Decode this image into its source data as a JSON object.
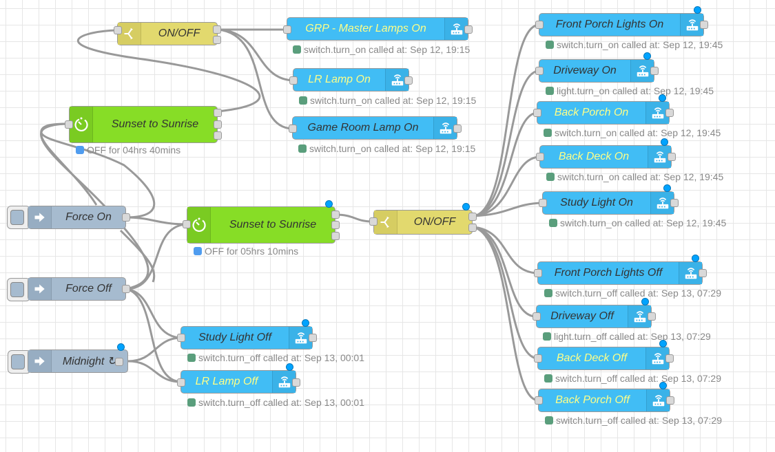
{
  "flow": {
    "colors": {
      "switch_node": "#e2d96e",
      "time_node": "#87dd26",
      "inject_node": "#a6bbcf",
      "ha_service_node": "#41bdf5",
      "status_green": "#5a9e7c",
      "status_blue": "#4f9cef",
      "changed_dot": "#00a3ff",
      "wire": "#999999"
    },
    "nodes": {
      "switch_top": {
        "label": "ON/OFF",
        "icon": "switch-icon"
      },
      "grp_master": {
        "label": "GRP - Master Lamps On",
        "icon": "router-icon",
        "status": "switch.turn_on called at: Sep 12, 19:15"
      },
      "lr_lamp_on": {
        "label": "LR Lamp On",
        "icon": "router-icon",
        "status": "switch.turn_on called at: Sep 12, 19:15"
      },
      "game_room_on": {
        "label": "Game Room Lamp On",
        "icon": "router-icon",
        "status": "switch.turn_on called at: Sep 12, 19:15"
      },
      "sunset_top": {
        "label": "Sunset to Sunrise",
        "icon": "timer-icon",
        "status": "OFF for 04hrs 40mins"
      },
      "force_on": {
        "label": "Force On",
        "icon": "inject-arrow-icon"
      },
      "force_off": {
        "label": "Force Off",
        "icon": "inject-arrow-icon"
      },
      "midnight": {
        "label": "Midnight ↻",
        "icon": "inject-arrow-icon"
      },
      "sunset_mid": {
        "label": "Sunset to Sunrise",
        "icon": "timer-icon",
        "status": "OFF for 05hrs 10mins"
      },
      "switch_mid": {
        "label": "ON/OFF",
        "icon": "switch-icon"
      },
      "study_light_off": {
        "label": "Study Light Off",
        "icon": "router-icon",
        "status": "switch.turn_off called at: Sep 13, 00:01"
      },
      "lr_lamp_off": {
        "label": "LR Lamp Off",
        "icon": "router-icon",
        "status": "switch.turn_off called at: Sep 13, 00:01"
      },
      "front_porch_on": {
        "label": "Front Porch Lights On",
        "icon": "router-icon",
        "status": "switch.turn_on called at: Sep 12, 19:45"
      },
      "driveway_on": {
        "label": "Driveway On",
        "icon": "router-icon",
        "status": "light.turn_on called at: Sep 12, 19:45"
      },
      "back_porch_on": {
        "label": "Back Porch On",
        "icon": "router-icon",
        "status": "switch.turn_on called at: Sep 12, 19:45"
      },
      "back_deck_on": {
        "label": "Back Deck On",
        "icon": "router-icon",
        "status": "switch.turn_on called at: Sep 12, 19:45"
      },
      "study_light_on": {
        "label": "Study Light On",
        "icon": "router-icon",
        "status": "switch.turn_on called at: Sep 12, 19:45"
      },
      "front_porch_off": {
        "label": "Front Porch Lights Off",
        "icon": "router-icon",
        "status": "switch.turn_off called at: Sep 13, 07:29"
      },
      "driveway_off": {
        "label": "Driveway Off",
        "icon": "router-icon",
        "status": "light.turn_off called at: Sep 13, 07:29"
      },
      "back_deck_off": {
        "label": "Back Deck Off",
        "icon": "router-icon",
        "status": "switch.turn_off called at: Sep 13, 07:29"
      },
      "back_porch_off": {
        "label": "Back Porch Off",
        "icon": "router-icon",
        "status": "switch.turn_off called at: Sep 13, 07:29"
      }
    }
  }
}
